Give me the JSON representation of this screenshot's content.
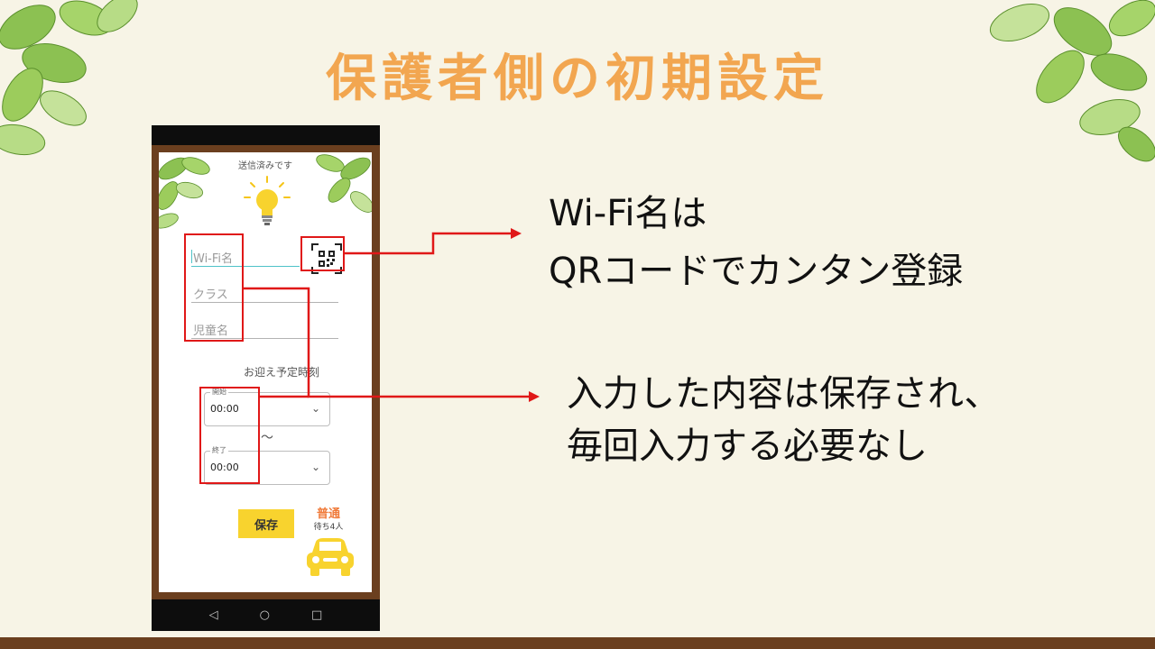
{
  "slide": {
    "title": "保護者側の初期設定"
  },
  "phone": {
    "status_text": "送信済みです",
    "form": {
      "wifi_placeholder": "Wi-Fi名",
      "class_placeholder": "クラス",
      "child_placeholder": "児童名"
    },
    "pickup": {
      "label": "お迎え予定時刻",
      "start_legend": "開始",
      "start_value": "00:00",
      "range_separator": "～",
      "end_legend": "終了",
      "end_value": "00:00"
    },
    "save_label": "保存",
    "status": {
      "label": "普通",
      "waiting": "待ち4人"
    },
    "nav": {
      "back": "◁",
      "home": "○",
      "recent": "□"
    }
  },
  "callouts": {
    "qr_line1": "Wi-Fi名は",
    "qr_line2": "QRコードでカンタン登録",
    "saved_line1": "入力した内容は保存され、",
    "saved_line2": "毎回入力する必要なし"
  },
  "colors": {
    "title": "#f2a650",
    "highlight": "#e01818",
    "frame": "#6b3f1f",
    "save_button": "#f8d32e",
    "status": "#f07c3c"
  }
}
